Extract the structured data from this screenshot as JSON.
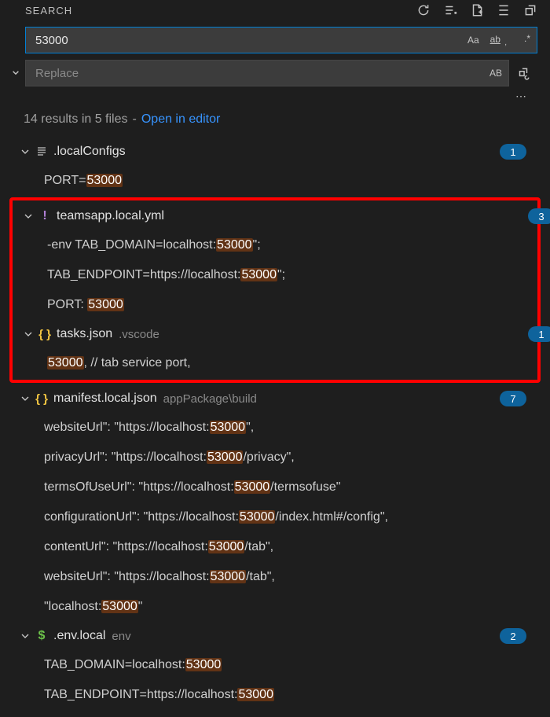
{
  "header": {
    "title": "SEARCH"
  },
  "input": {
    "search_value": "53000",
    "replace_placeholder": "Replace",
    "caseSensitive_label": "Aa",
    "wholeWord_label": "ab",
    "regex_label": ".*",
    "preserveCase_label": "AB"
  },
  "summary": {
    "count_text": "14 results in 5 files",
    "sep": " - ",
    "link_label": "Open in editor"
  },
  "files": [
    {
      "name": ".localConfigs",
      "path": "",
      "icon": "lines",
      "badge": "1",
      "matches": [
        {
          "pre": "PORT=",
          "hit": "53000",
          "post": ""
        }
      ]
    },
    {
      "name": "teamsapp.local.yml",
      "path": "",
      "icon": "exclaim",
      "badge": "3",
      "matches": [
        {
          "pre": "-env TAB_DOMAIN=localhost:",
          "hit": "53000",
          "post": "\";"
        },
        {
          "pre": "TAB_ENDPOINT=https://localhost:",
          "hit": "53000",
          "post": "\";"
        },
        {
          "pre": "PORT: ",
          "hit": "53000",
          "post": ""
        }
      ]
    },
    {
      "name": "tasks.json",
      "path": ".vscode",
      "icon": "braces",
      "badge": "1",
      "matches": [
        {
          "pre": "",
          "hit": "53000",
          "post": ", // tab service port,"
        }
      ]
    },
    {
      "name": "manifest.local.json",
      "path": "appPackage\\build",
      "icon": "braces",
      "badge": "7",
      "matches": [
        {
          "pre": "websiteUrl\": \"https://localhost:",
          "hit": "53000",
          "post": "\","
        },
        {
          "pre": "privacyUrl\": \"https://localhost:",
          "hit": "53000",
          "post": "/privacy\","
        },
        {
          "pre": "termsOfUseUrl\": \"https://localhost:",
          "hit": "53000",
          "post": "/termsofuse\""
        },
        {
          "pre": "configurationUrl\": \"https://localhost:",
          "hit": "53000",
          "post": "/index.html#/config\","
        },
        {
          "pre": "contentUrl\": \"https://localhost:",
          "hit": "53000",
          "post": "/tab\","
        },
        {
          "pre": "websiteUrl\": \"https://localhost:",
          "hit": "53000",
          "post": "/tab\","
        },
        {
          "pre": "\"localhost:",
          "hit": "53000",
          "post": "\""
        }
      ]
    },
    {
      "name": ".env.local",
      "path": "env",
      "icon": "dollar",
      "badge": "2",
      "matches": [
        {
          "pre": "TAB_DOMAIN=localhost:",
          "hit": "53000",
          "post": ""
        },
        {
          "pre": "TAB_ENDPOINT=https://localhost:",
          "hit": "53000",
          "post": ""
        }
      ]
    }
  ]
}
